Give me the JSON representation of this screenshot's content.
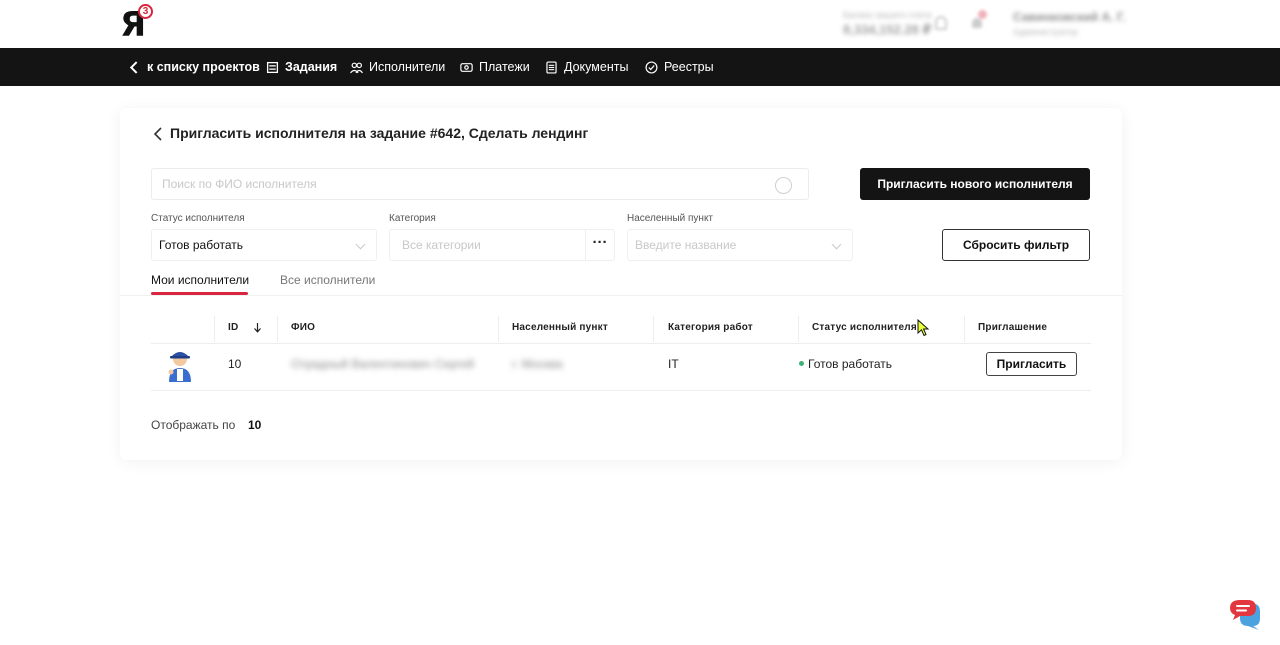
{
  "header": {
    "logo_text": "Я",
    "logo_badge": "3",
    "balance_label": "Баланс вашего счета",
    "balance_value": "8,334,152.28 ₽",
    "user_name": "Савинковский А. Г.",
    "user_role": "Администратор"
  },
  "nav": {
    "back": "к списку проектов",
    "items": [
      {
        "label": "Задания",
        "icon": "tasks-icon"
      },
      {
        "label": "Исполнители",
        "icon": "users-icon"
      },
      {
        "label": "Платежи",
        "icon": "payments-icon"
      },
      {
        "label": "Документы",
        "icon": "documents-icon"
      },
      {
        "label": "Реестры",
        "icon": "registry-icon"
      }
    ]
  },
  "page": {
    "title": "Пригласить исполнителя на задание #642, Сделать лендинг",
    "search_placeholder": "Поиск по ФИО исполнителя",
    "invite_new_button": "Пригласить нового исполнителя",
    "reset_filter_button": "Сбросить фильтр"
  },
  "filters": {
    "status": {
      "label": "Статус исполнителя",
      "value": "Готов работать"
    },
    "category": {
      "label": "Категория",
      "placeholder": "Все категории"
    },
    "city": {
      "label": "Населенный пункт",
      "placeholder": "Введите название"
    }
  },
  "tabs": {
    "my": "Мои исполнители",
    "all": "Все исполнители"
  },
  "table": {
    "headers": {
      "id": "ID",
      "fio": "ФИО",
      "city": "Населенный пункт",
      "category": "Категория работ",
      "status": "Статус исполнителя",
      "invite": "Приглашение"
    },
    "rows": [
      {
        "id": "10",
        "fio": "Отрадный Валентинович Сергей",
        "city": "г. Москва",
        "category": "IT",
        "status": "Готов работать",
        "invite_button": "Пригласить"
      }
    ]
  },
  "pagination": {
    "label": "Отображать по",
    "value": "10"
  },
  "colors": {
    "accent": "#d7263d",
    "nav_bg": "#141414",
    "status_green": "#3cb371"
  }
}
